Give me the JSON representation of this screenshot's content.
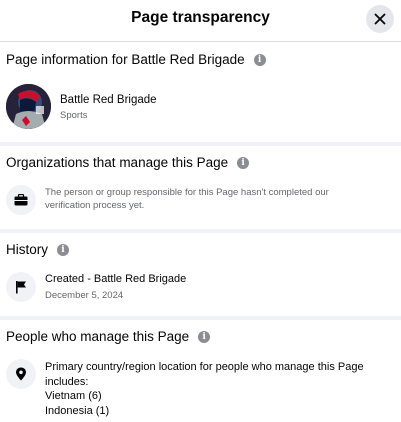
{
  "dialog": {
    "title": "Page transparency",
    "close_icon": "close-icon"
  },
  "page_info": {
    "heading": "Page information for Battle Red Brigade",
    "page_name": "Battle Red Brigade",
    "category": "Sports",
    "avatar_icon": "page-avatar"
  },
  "organizations": {
    "heading": "Organizations that manage this Page",
    "icon": "briefcase-icon",
    "text": "The person or group responsible for this Page hasn't completed our verification process yet."
  },
  "history": {
    "heading": "History",
    "icon": "flag-icon",
    "created": "Created - Battle Red Brigade",
    "date": "December 5, 2024"
  },
  "people": {
    "heading": "People who manage this Page",
    "icon": "location-pin-icon",
    "intro": "Primary country/region location for people who manage this Page includes:",
    "countries": [
      "Vietnam (6)",
      "Indonesia (1)"
    ]
  },
  "colors": {
    "divider": "#f0f2f5",
    "secondary_text": "#65676b",
    "icon_gray": "#8a8d91"
  }
}
